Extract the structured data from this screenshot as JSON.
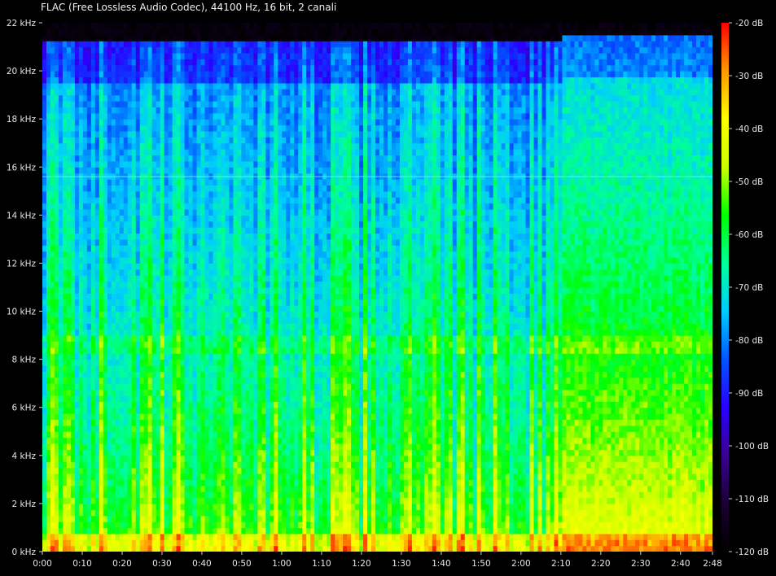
{
  "window": {
    "title": "FLAC (Free Lossless Audio Codec), 44100 Hz, 16 bit, 2 canali"
  },
  "chart_data": {
    "type": "heatmap",
    "title": "FLAC (Free Lossless Audio Codec), 44100 Hz, 16 bit, 2 canali",
    "xlabel": "",
    "ylabel": "",
    "x_ticks": [
      "0:00",
      "0:10",
      "0:20",
      "0:30",
      "0:40",
      "0:50",
      "1:00",
      "1:10",
      "1:20",
      "1:30",
      "1:40",
      "1:50",
      "2:00",
      "2:10",
      "2:20",
      "2:30",
      "2:40",
      "2:48"
    ],
    "x_tick_seconds": [
      0,
      10,
      20,
      30,
      40,
      50,
      60,
      70,
      80,
      90,
      100,
      110,
      120,
      130,
      140,
      150,
      160,
      168
    ],
    "xlim_seconds": [
      0,
      168
    ],
    "y_ticks": [
      "0 kHz",
      "2 kHz",
      "4 kHz",
      "6 kHz",
      "8 kHz",
      "10 kHz",
      "12 kHz",
      "14 kHz",
      "16 kHz",
      "18 kHz",
      "20 kHz",
      "22 kHz"
    ],
    "y_tick_khz": [
      0,
      2,
      4,
      6,
      8,
      10,
      12,
      14,
      16,
      18,
      20,
      22
    ],
    "ylim_khz": [
      0,
      22
    ],
    "colorbar": {
      "ticks": [
        "-20 dB",
        "-30 dB",
        "-40 dB",
        "-50 dB",
        "-60 dB",
        "-70 dB",
        "-80 dB",
        "-90 dB",
        "-100 dB",
        "-110 dB",
        "-120 dB"
      ],
      "tick_db": [
        -20,
        -30,
        -40,
        -50,
        -60,
        -70,
        -80,
        -90,
        -100,
        -110,
        -120
      ],
      "range_db": [
        -120,
        -20
      ]
    },
    "features": {
      "lowpass_cutoff_khz_before_2_10": 20.8,
      "lowpass_cutoff_khz_after_2_10": 21.0,
      "tone_line_khz": 15.6,
      "section_change_seconds": 130
    },
    "colors": {
      "background": "#000000",
      "grid_text": "#e6e6e6",
      "colormap": [
        "#000000",
        "#1a0033",
        "#3a0090",
        "#2b00ff",
        "#0055ff",
        "#00ccff",
        "#00ff99",
        "#00ff00",
        "#ccff00",
        "#ffff00",
        "#ff9900",
        "#ff0000"
      ]
    }
  }
}
